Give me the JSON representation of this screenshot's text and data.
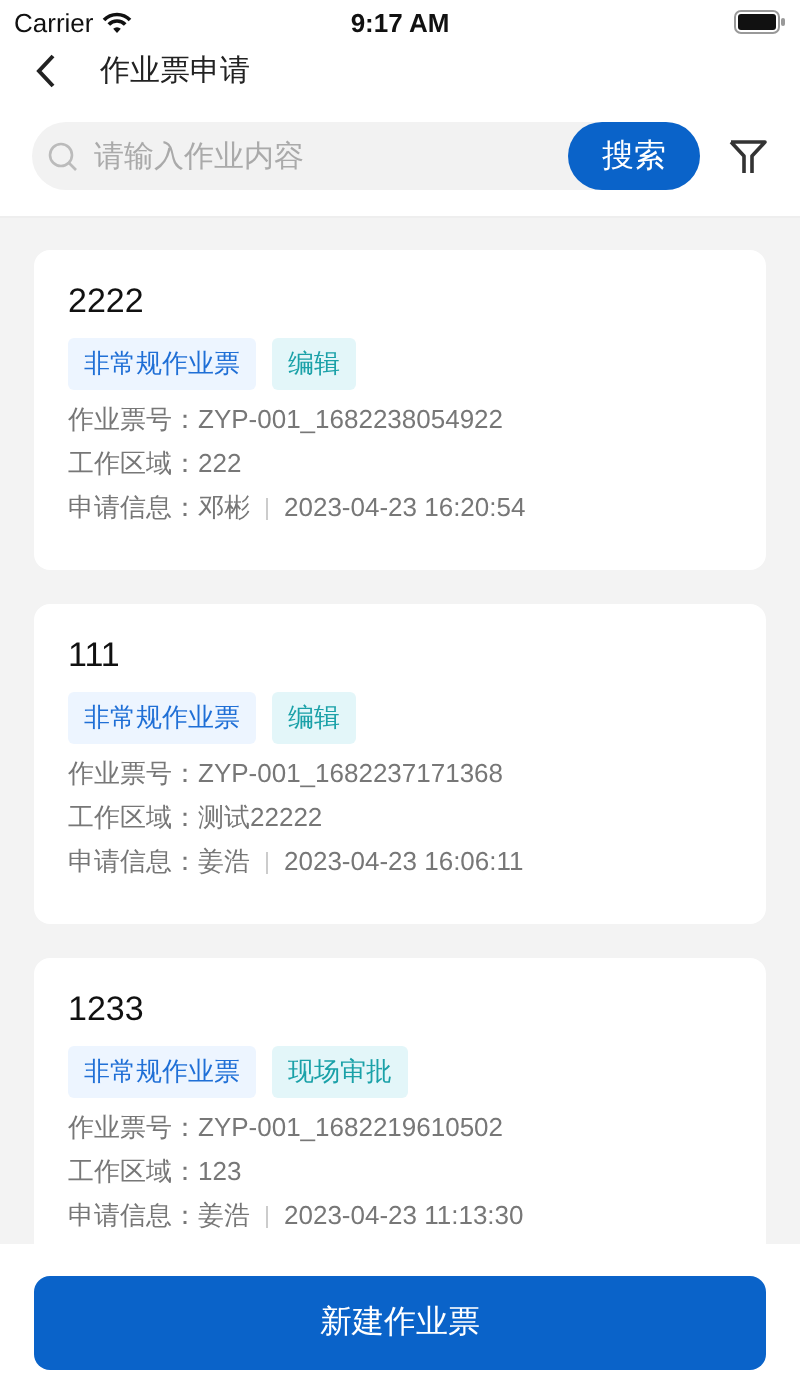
{
  "status_bar": {
    "carrier": "Carrier",
    "time": "9:17 AM"
  },
  "header": {
    "title": "作业票申请"
  },
  "search": {
    "placeholder": "请输入作业内容",
    "button": "搜索"
  },
  "tickets": [
    {
      "title": "2222",
      "tags": [
        {
          "kind": "type",
          "label": "非常规作业票"
        },
        {
          "kind": "status",
          "label": "编辑"
        }
      ],
      "number_label": "作业票号：",
      "number": "ZYP-001_1682238054922",
      "area_label": "工作区域：",
      "area": "222",
      "info_label": "申请信息：",
      "applicant": "邓彬",
      "time": "2023-04-23 16:20:54"
    },
    {
      "title": "111",
      "tags": [
        {
          "kind": "type",
          "label": "非常规作业票"
        },
        {
          "kind": "status",
          "label": "编辑"
        }
      ],
      "number_label": "作业票号：",
      "number": "ZYP-001_1682237171368",
      "area_label": "工作区域：",
      "area": "测试22222",
      "info_label": "申请信息：",
      "applicant": "姜浩",
      "time": "2023-04-23 16:06:11"
    },
    {
      "title": "1233",
      "tags": [
        {
          "kind": "type",
          "label": "非常规作业票"
        },
        {
          "kind": "status",
          "label": "现场审批"
        }
      ],
      "number_label": "作业票号：",
      "number": "ZYP-001_1682219610502",
      "area_label": "工作区域：",
      "area": "123",
      "info_label": "申请信息：",
      "applicant": "姜浩",
      "time": "2023-04-23 11:13:30"
    }
  ],
  "create_button": "新建作业票"
}
